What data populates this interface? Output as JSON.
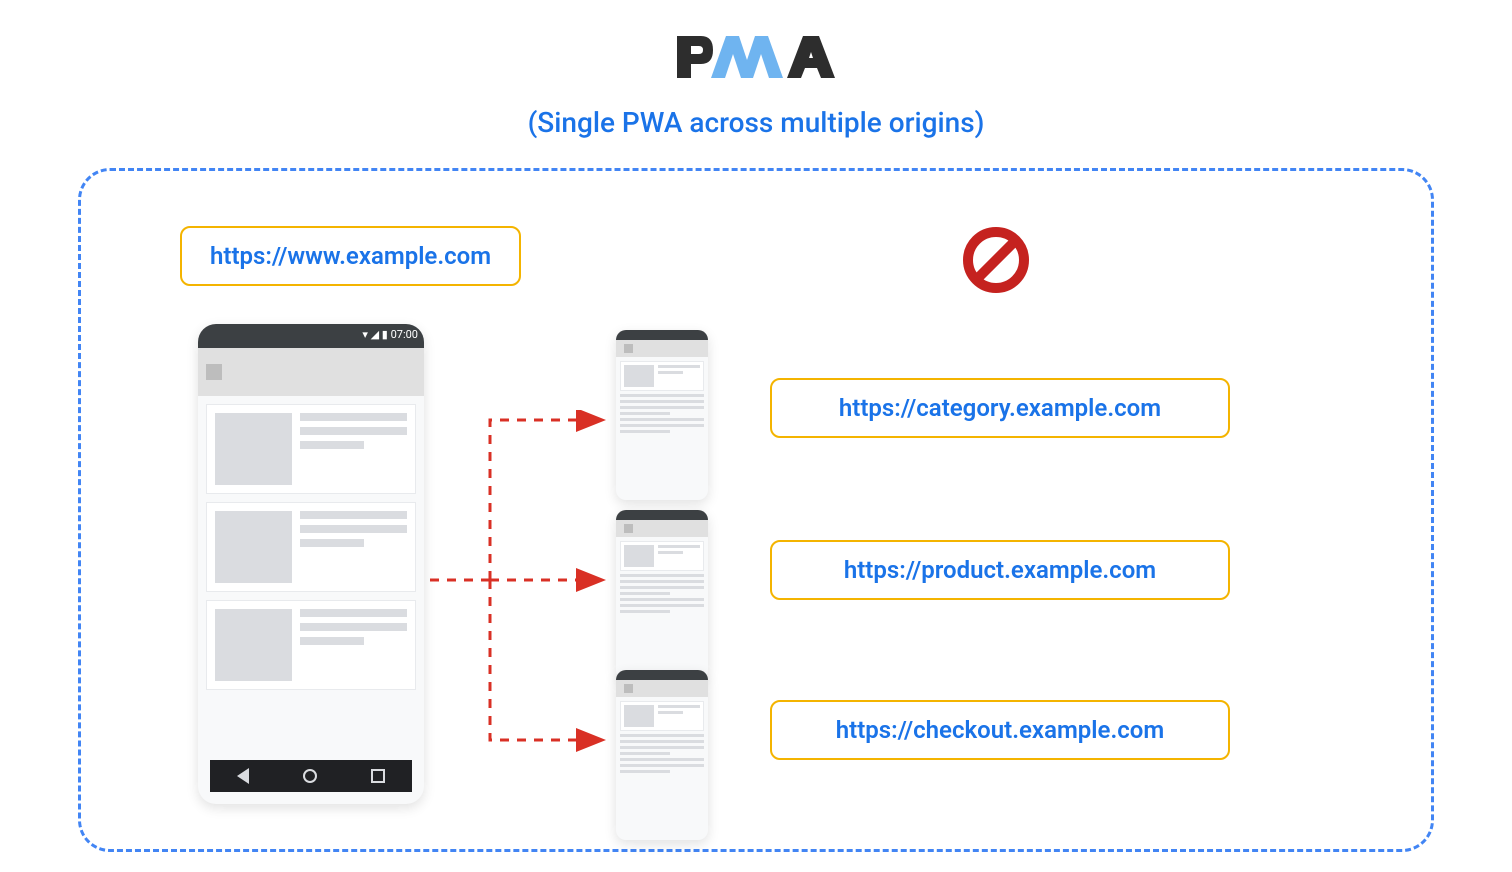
{
  "title": "(Single PWA across multiple origins)",
  "logo_text": "PWA",
  "main_origin": "https://www.example.com",
  "origins": [
    "https://category.example.com",
    "https://product.example.com",
    "https://checkout.example.com"
  ],
  "prohibit_icon": "no-entry",
  "phone_status_time": "07:00",
  "colors": {
    "blue": "#1a73e8",
    "dashed_blue": "#4285f4",
    "label_border": "#f4b400",
    "arrow_red": "#d93025",
    "prohibit_red": "#c5221f"
  }
}
